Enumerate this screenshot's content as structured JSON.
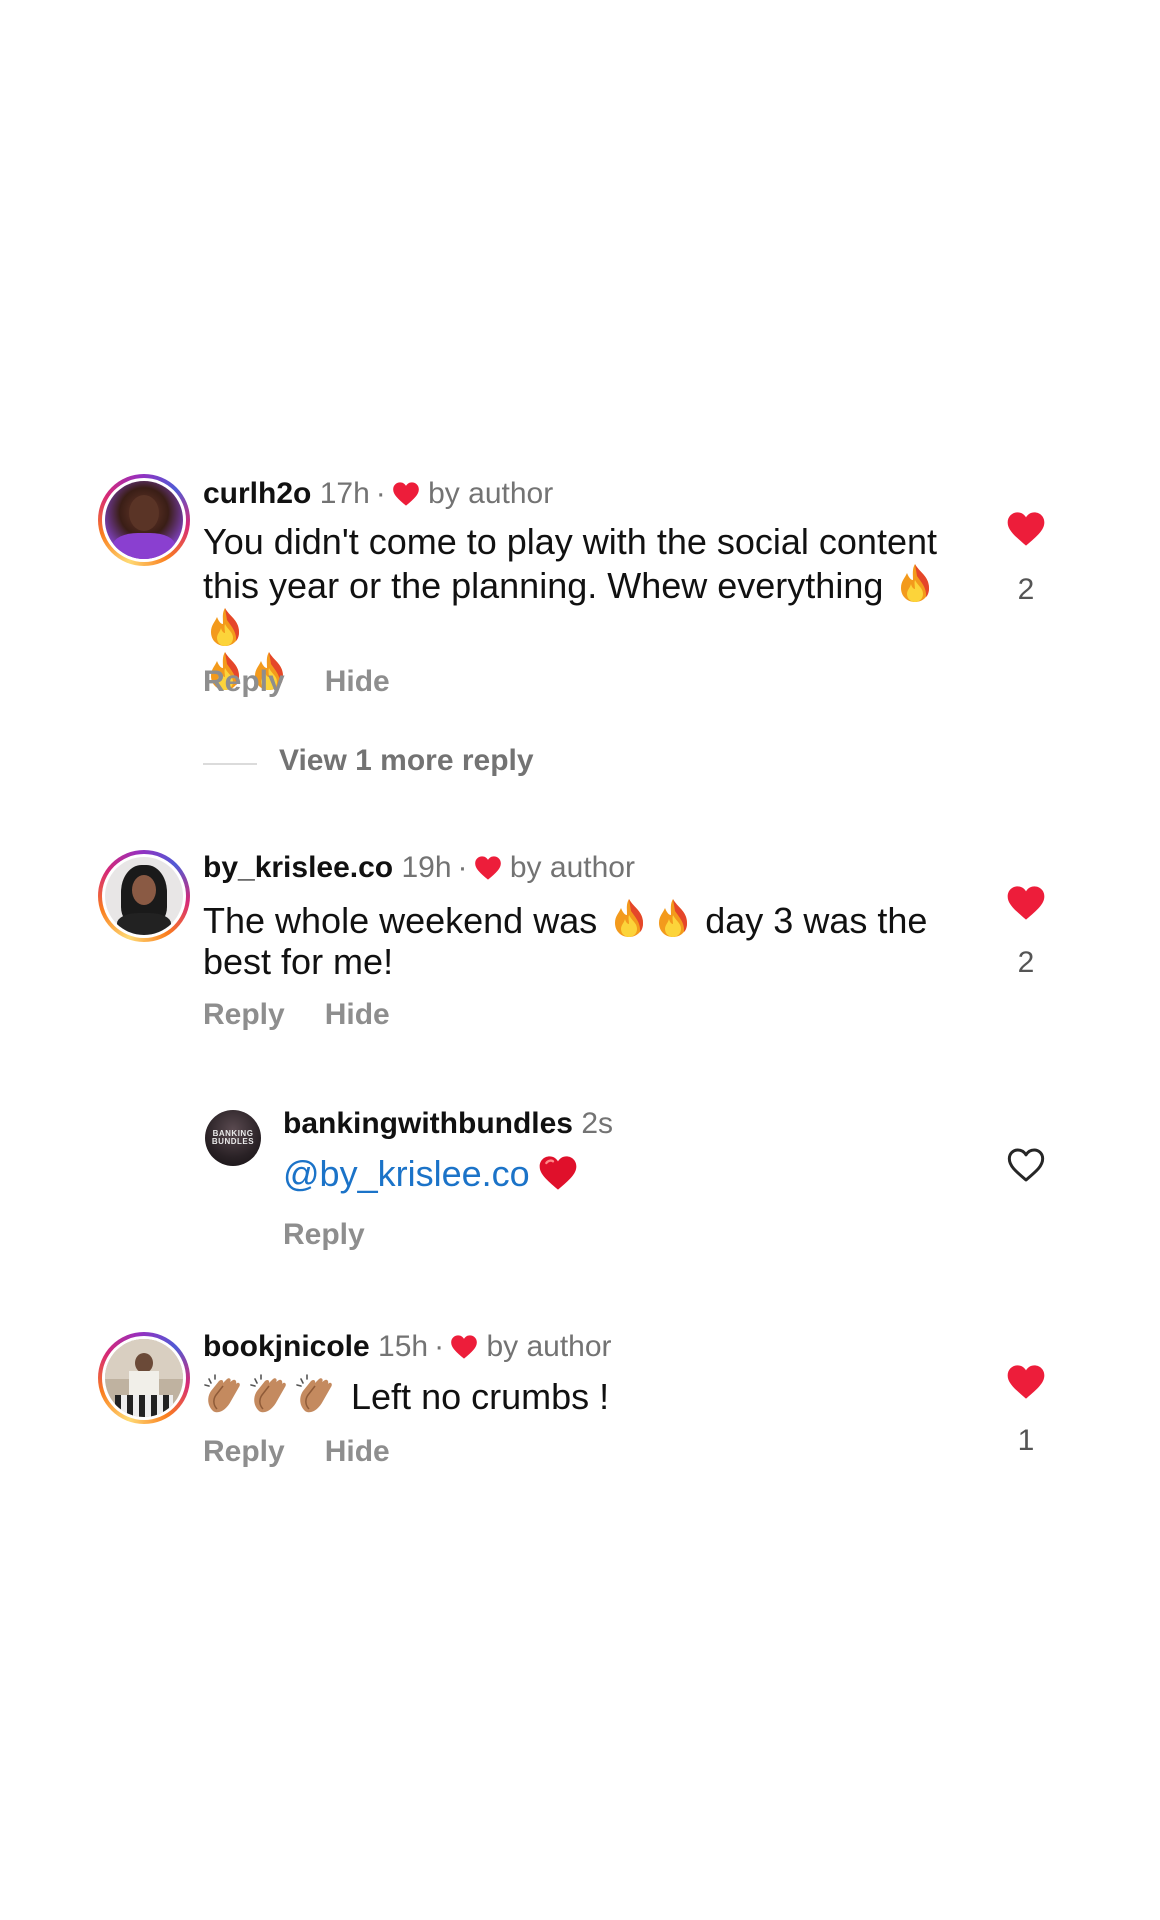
{
  "colors": {
    "like_red": "#ed1d3a",
    "muted_text": "#737373",
    "action_text": "#8e8e8e",
    "mention_blue": "#1b73c8"
  },
  "comments": [
    {
      "username": "curlh2o",
      "time": "17h",
      "dot": "·",
      "liked_by_author": "by author",
      "text_part1": "You didn't come to play with the social content this year or the planning. Whew everything",
      "emoji_after_text": "fire-icon ×4",
      "reply_label": "Reply",
      "hide_label": "Hide",
      "like_count": "2",
      "liked": true
    },
    {
      "username": "by_krislee.co",
      "time": "19h",
      "dot": "·",
      "liked_by_author": "by author",
      "text_part1": "The whole weekend was",
      "text_part2": "day 3 was the best for me!",
      "reply_label": "Reply",
      "hide_label": "Hide",
      "like_count": "2",
      "liked": true
    },
    {
      "username": "bookjnicole",
      "time": "15h",
      "dot": "·",
      "liked_by_author": "by author",
      "text_part1": "Left no crumbs !",
      "reply_label": "Reply",
      "hide_label": "Hide",
      "like_count": "1",
      "liked": true
    }
  ],
  "view_more_replies": "View 1 more reply",
  "reply": {
    "username": "bankingwithbundles",
    "time": "2s",
    "mention": "@by_krislee.co",
    "reply_label": "Reply",
    "avatar_text": "BANKING BUNDLES",
    "liked": false
  }
}
